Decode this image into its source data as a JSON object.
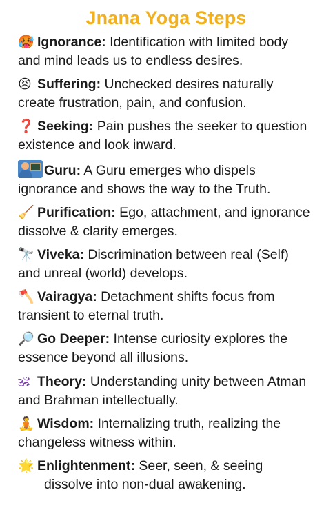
{
  "title": "Jnana Yoga Steps",
  "steps": [
    {
      "icon": "🥵",
      "icon_name": "angry-face-icon",
      "name": "Ignorance:",
      "desc": " Identification with limited body and mind leads us to endless desires."
    },
    {
      "icon": "😣",
      "icon_name": "persevering-face-icon",
      "name": "Suffering:",
      "desc": " Unchecked desires naturally create frustration, pain, and confusion."
    },
    {
      "icon": "❓",
      "icon_name": "question-mark-icon",
      "name": "Seeking:",
      "desc": " Pain pushes the seeker to question existence and look inward."
    },
    {
      "icon": "",
      "icon_name": "teacher-icon",
      "name": "Guru:",
      "desc": " A Guru emerges who dispels ignorance and shows the way to the Truth."
    },
    {
      "icon": "🧹",
      "icon_name": "broom-icon",
      "name": "Purification:",
      "desc": " Ego, attachment, and ignorance dissolve & clarity emerges."
    },
    {
      "icon": "🔭",
      "icon_name": "telescope-icon",
      "name": "Viveka:",
      "desc": " Discrimination between real (Self) and unreal (world) develops."
    },
    {
      "icon": "🪓",
      "icon_name": "axe-icon",
      "name": "Vairagya:",
      "desc": " Detachment shifts focus from transient to eternal truth."
    },
    {
      "icon": "🔎",
      "icon_name": "magnifier-icon",
      "name": "Go Deeper:",
      "desc": " Intense curiosity explores the essence beyond all illusions."
    },
    {
      "icon": "🕉",
      "icon_name": "om-icon",
      "name": "Theory:",
      "desc": " Understanding unity between Atman and Brahman intellectually."
    },
    {
      "icon": "🧘",
      "icon_name": "meditation-icon",
      "name": "Wisdom:",
      "desc": " Internalizing truth, realizing the changeless witness within."
    },
    {
      "icon": "🌟",
      "icon_name": "sun-burst-icon",
      "name": "Enlightenment:",
      "desc_first": " Seer, seen, & seeing",
      "desc_rest": "dissolve into non-dual awakening."
    }
  ],
  "colors": {
    "title": "#f0b020",
    "text": "#1b1b1b",
    "background": "#ffffff"
  }
}
